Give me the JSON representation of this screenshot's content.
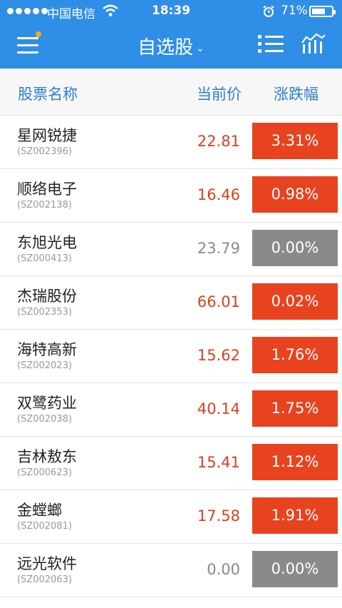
{
  "status_bar": {
    "carrier": "中国电信",
    "time": "18:39",
    "battery": "71%",
    "battery_level": 0.71
  },
  "nav": {
    "title": "自选股",
    "title_chevron": "⌄",
    "left_icon": "hamburger-menu-icon",
    "right_icons": [
      "list-icon",
      "chart-icon"
    ]
  },
  "table": {
    "headers": {
      "name": "股票名称",
      "price": "当前价",
      "change": "涨跌幅"
    },
    "rows": [
      {
        "name": "星网锐捷",
        "code": "(SZ002396)",
        "price": "22.81",
        "change": "3.31%",
        "state": "up"
      },
      {
        "name": "顺络电子",
        "code": "(SZ002138)",
        "price": "16.46",
        "change": "0.98%",
        "state": "up"
      },
      {
        "name": "东旭光电",
        "code": "(SZ000413)",
        "price": "23.79",
        "change": "0.00%",
        "state": "flat"
      },
      {
        "name": "杰瑞股份",
        "code": "(SZ002353)",
        "price": "66.01",
        "change": "0.02%",
        "state": "up"
      },
      {
        "name": "海特高新",
        "code": "(SZ002023)",
        "price": "15.62",
        "change": "1.76%",
        "state": "up"
      },
      {
        "name": "双鹭药业",
        "code": "(SZ002038)",
        "price": "40.14",
        "change": "1.75%",
        "state": "up"
      },
      {
        "name": "吉林敖东",
        "code": "(SZ000623)",
        "price": "15.41",
        "change": "1.12%",
        "state": "up"
      },
      {
        "name": "金螳螂",
        "code": "(SZ002081)",
        "price": "17.58",
        "change": "1.91%",
        "state": "up"
      },
      {
        "name": "远光软件",
        "code": "(SZ002063)",
        "price": "0.00",
        "change": "0.00%",
        "state": "flat"
      }
    ]
  },
  "colors": {
    "topbar": "#2f8ee6",
    "up_badge": "#e8431f",
    "up_price": "#d9401e",
    "flat_badge": "#8a8a8a",
    "flat_price": "#8a8a8a",
    "header_text": "#2f7fcb"
  }
}
